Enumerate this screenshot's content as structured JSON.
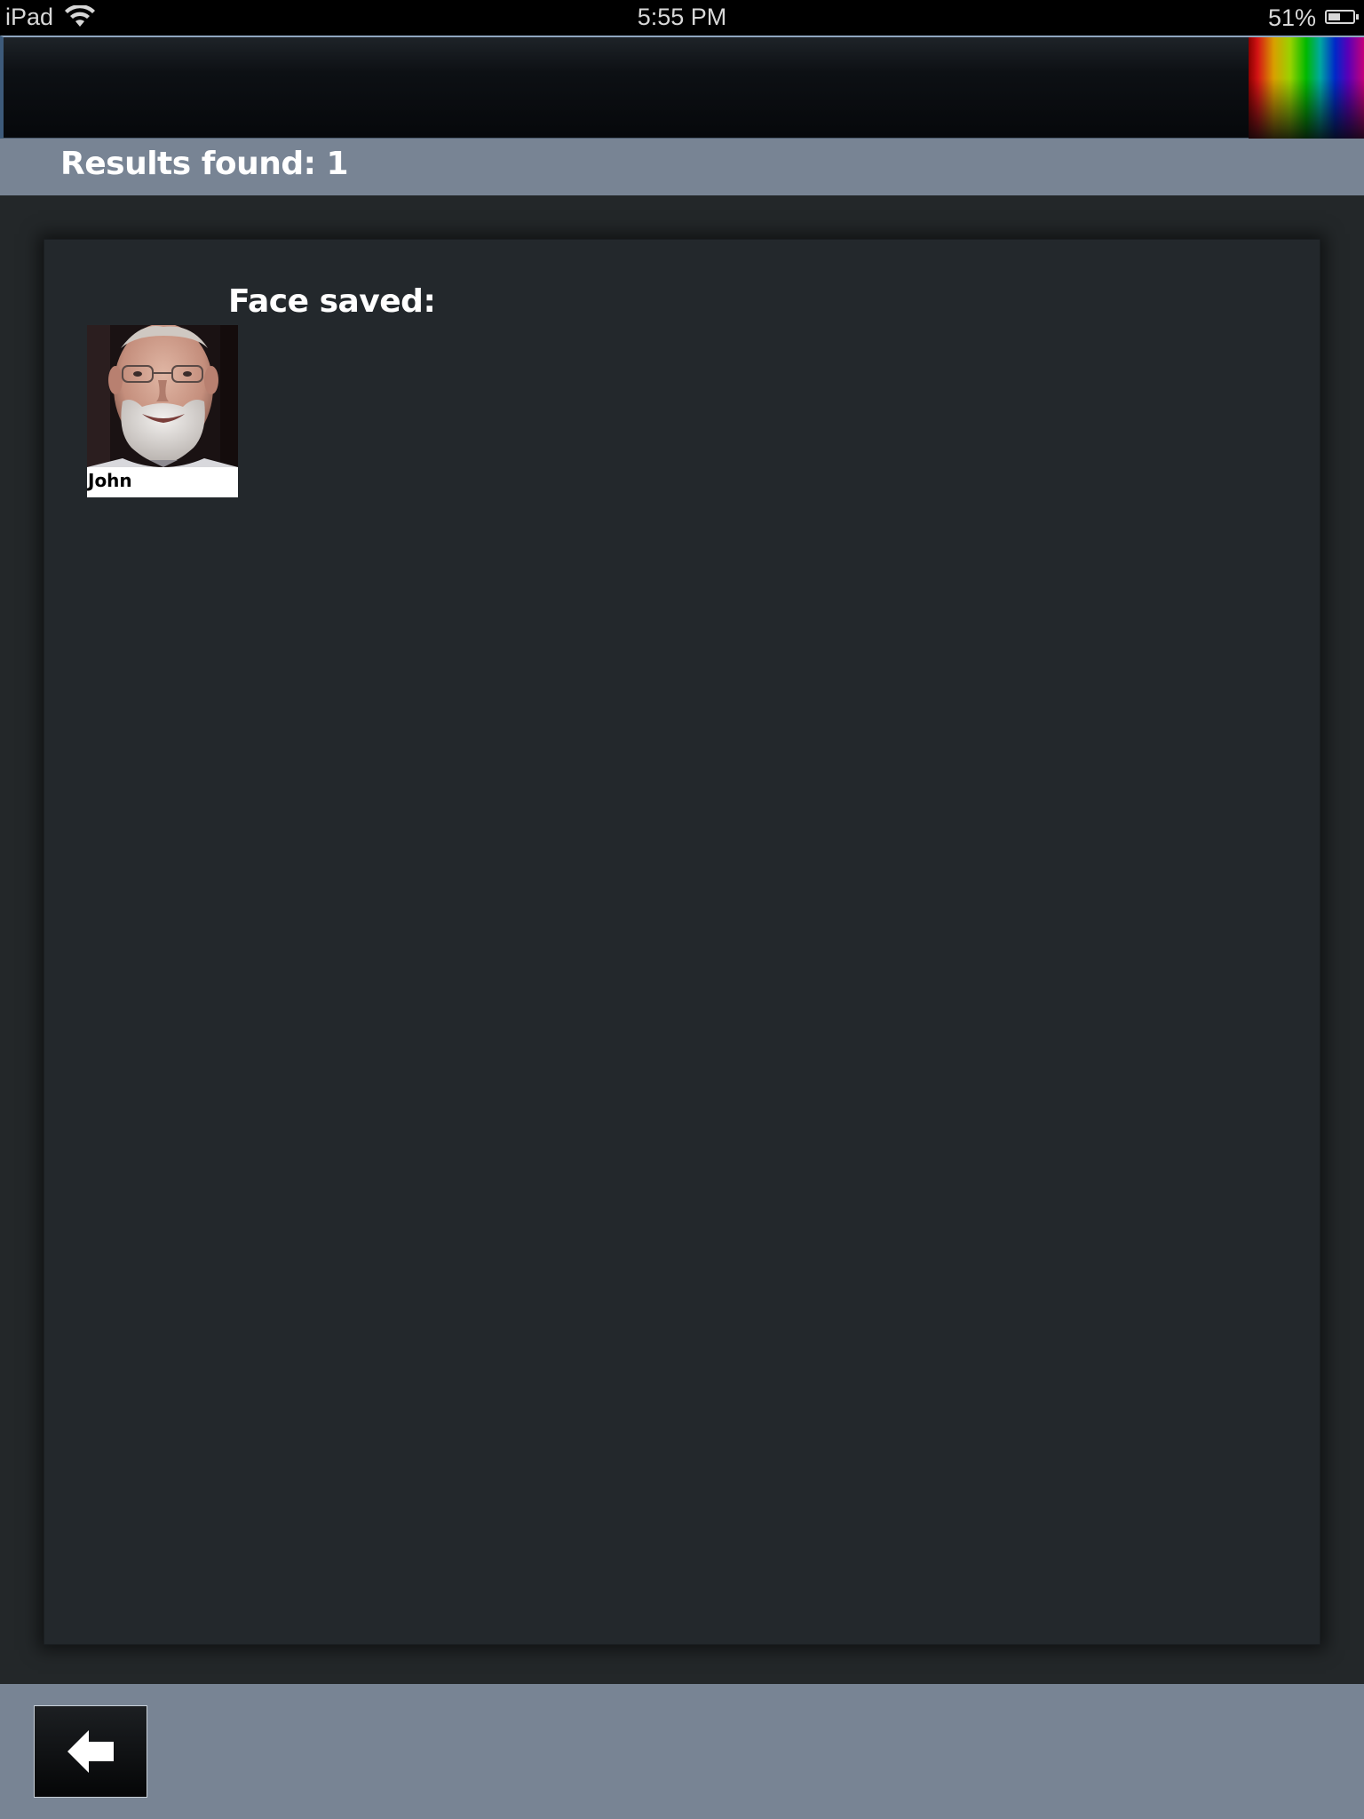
{
  "status_bar": {
    "device": "iPad",
    "time": "5:55 PM",
    "battery_percent": "51%",
    "battery_level": 0.51,
    "icons": [
      "wifi-icon",
      "battery-icon"
    ]
  },
  "header": {
    "logo": "spectrum-logo"
  },
  "results": {
    "label": "Results found: 1"
  },
  "panel": {
    "title": "Face saved:",
    "faces": [
      {
        "name": "John"
      }
    ]
  },
  "footer": {
    "back_icon": "arrow-left-icon"
  },
  "colors": {
    "bar": "#788494",
    "panel": "#23282c",
    "background": "#232729"
  }
}
